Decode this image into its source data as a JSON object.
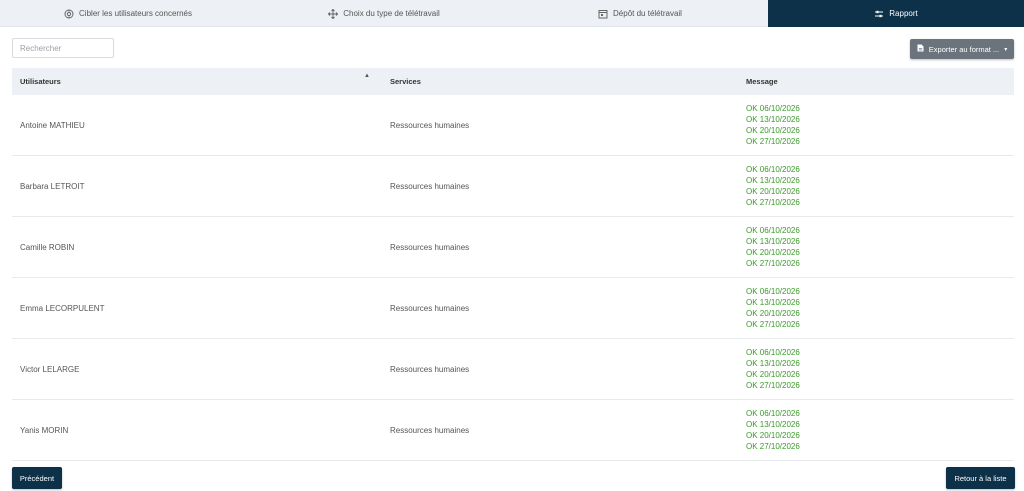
{
  "steps": [
    {
      "label": "Cibler les utilisateurs concernés",
      "icon": "target-icon"
    },
    {
      "label": "Choix du type de télétravail",
      "icon": "move-arrows-icon"
    },
    {
      "label": "Dépôt du télétravail",
      "icon": "calendar-icon"
    },
    {
      "label": "Rapport",
      "icon": "sliders-icon",
      "active": true
    }
  ],
  "search": {
    "placeholder": "Rechercher",
    "value": ""
  },
  "export": {
    "label": "Exporter au format ...",
    "icon": "file-icon",
    "caret": "▾"
  },
  "table": {
    "headers": {
      "user": "Utilisateurs",
      "sort": "▲",
      "service": "Services",
      "message": "Message"
    },
    "rows": [
      {
        "user": "Antoine MATHIEU",
        "service": "Ressources humaines",
        "messages": [
          "OK 06/10/2026",
          "OK 13/10/2026",
          "OK 20/10/2026",
          "OK 27/10/2026"
        ]
      },
      {
        "user": "Barbara LETROIT",
        "service": "Ressources humaines",
        "messages": [
          "OK 06/10/2026",
          "OK 13/10/2026",
          "OK 20/10/2026",
          "OK 27/10/2026"
        ]
      },
      {
        "user": "Camille ROBIN",
        "service": "Ressources humaines",
        "messages": [
          "OK 06/10/2026",
          "OK 13/10/2026",
          "OK 20/10/2026",
          "OK 27/10/2026"
        ]
      },
      {
        "user": "Emma LECORPULENT",
        "service": "Ressources humaines",
        "messages": [
          "OK 06/10/2026",
          "OK 13/10/2026",
          "OK 20/10/2026",
          "OK 27/10/2026"
        ]
      },
      {
        "user": "Victor LELARGE",
        "service": "Ressources humaines",
        "messages": [
          "OK 06/10/2026",
          "OK 13/10/2026",
          "OK 20/10/2026",
          "OK 27/10/2026"
        ]
      },
      {
        "user": "Yanis MORIN",
        "service": "Ressources humaines",
        "messages": [
          "OK 06/10/2026",
          "OK 13/10/2026",
          "OK 20/10/2026",
          "OK 27/10/2026"
        ]
      }
    ]
  },
  "footer": {
    "previous_label": "Précédent",
    "back_label": "Retour à la liste"
  },
  "colors": {
    "primary": "#0c3149",
    "ok_text": "#3a9a2a",
    "export_button": "#6b747d",
    "header_bg": "#edf0f5"
  }
}
